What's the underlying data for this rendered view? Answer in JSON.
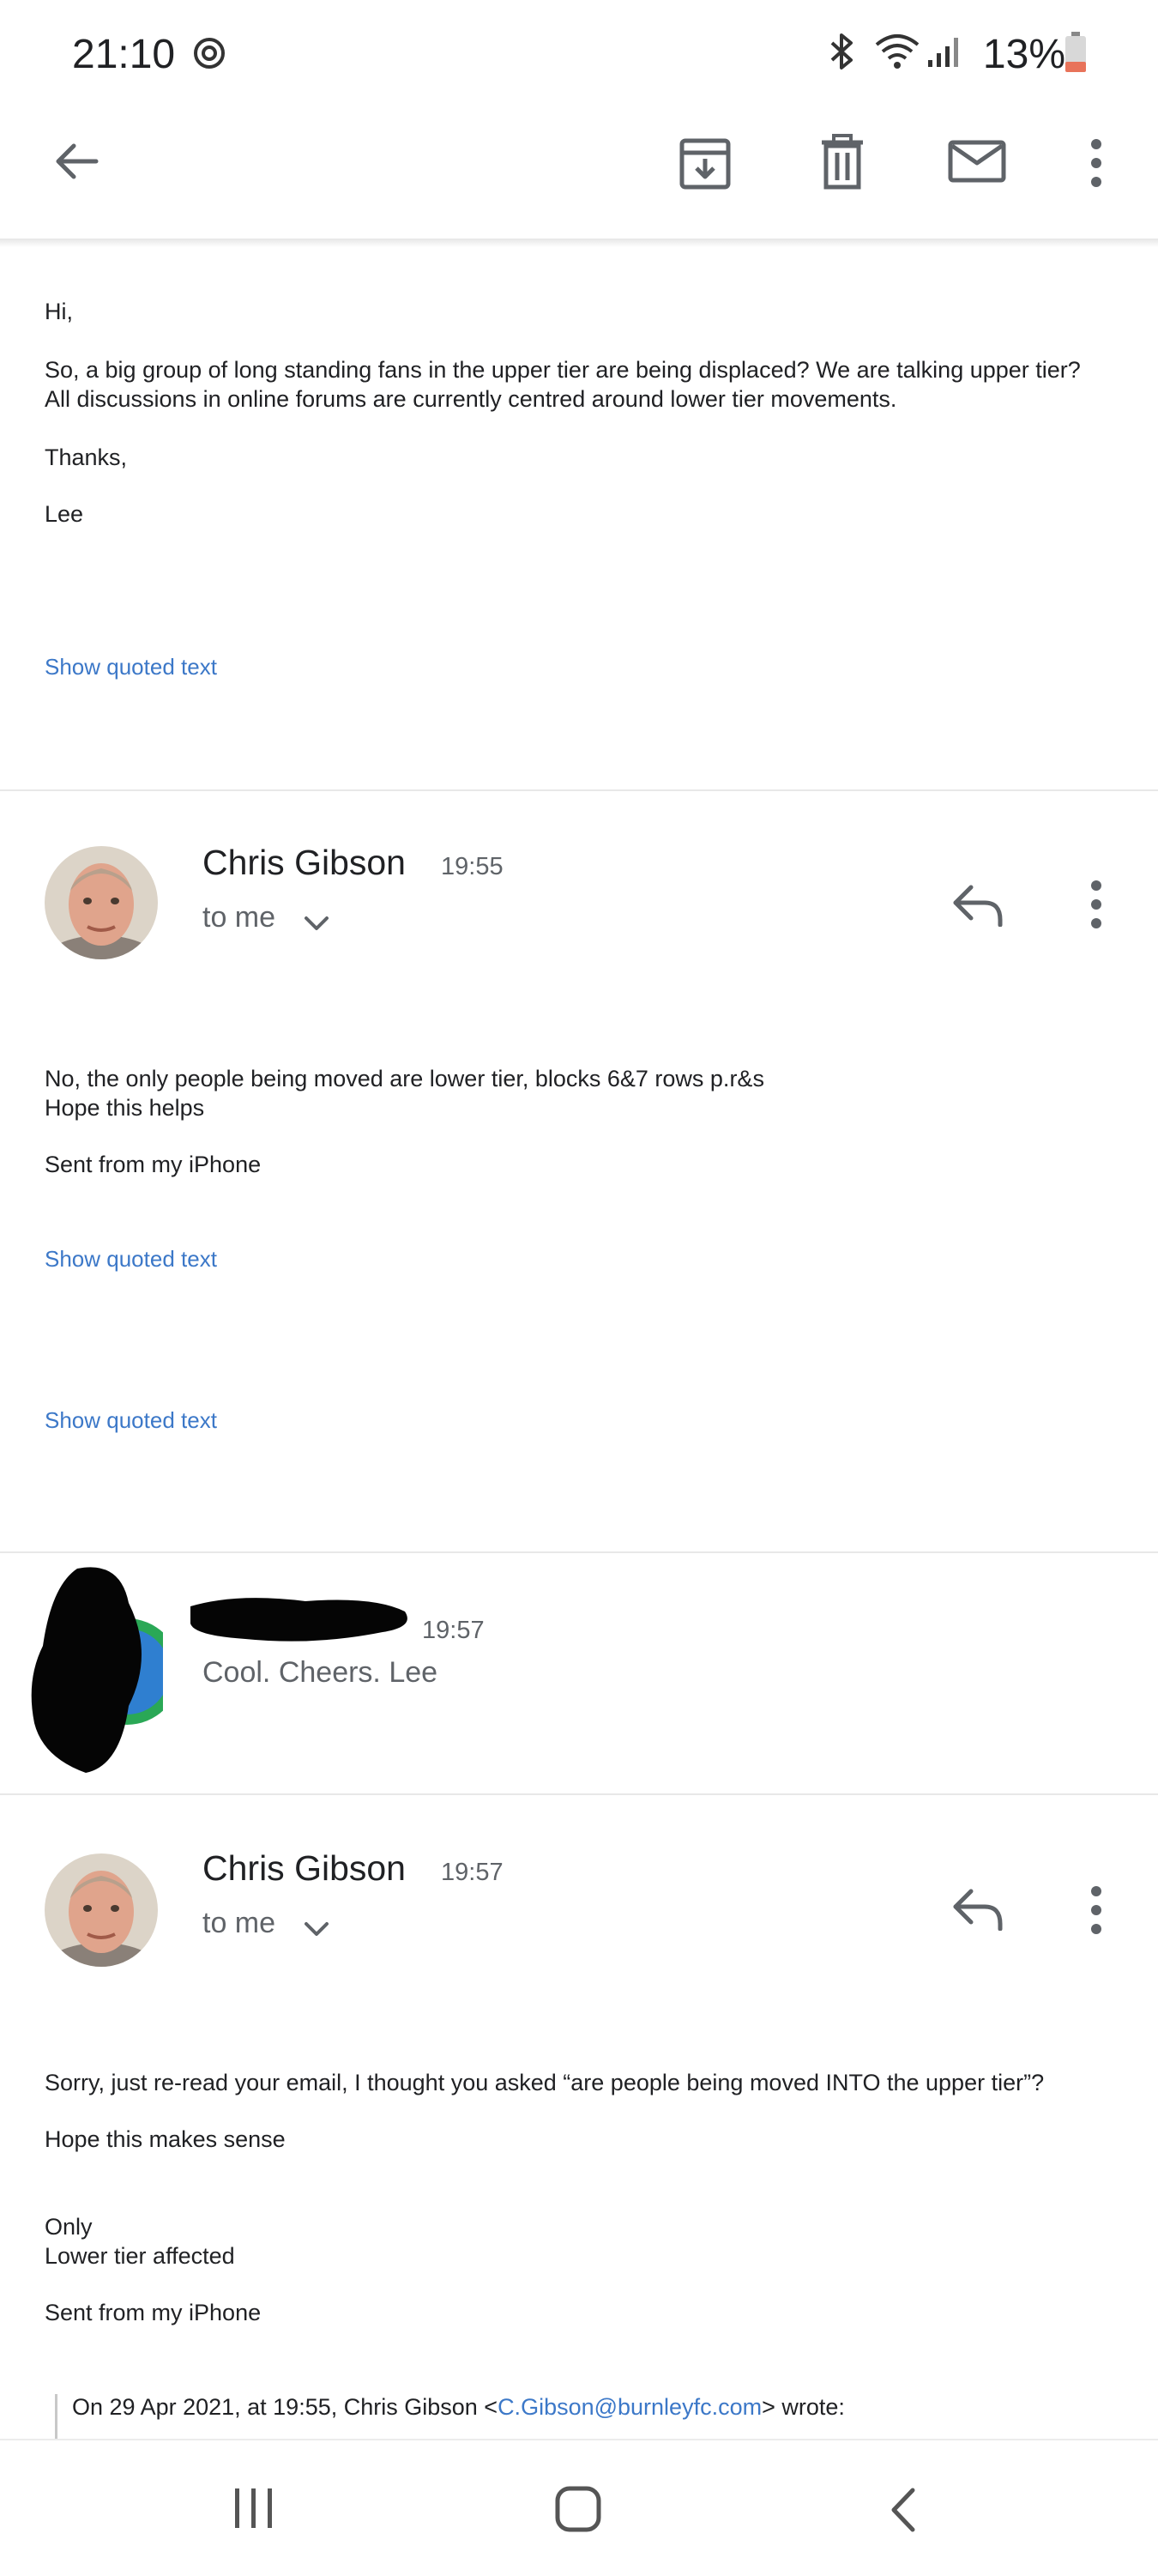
{
  "status_bar": {
    "time": "21:10",
    "battery": "13%",
    "icons": [
      "sync-icon",
      "bluetooth-icon",
      "wifi-icon",
      "signal-icon",
      "battery-icon"
    ]
  },
  "toolbar": {
    "back": "back-arrow-icon",
    "archive": "archive-icon",
    "delete": "trash-icon",
    "unread": "mail-icon",
    "more": "more-vert-icon"
  },
  "messages": [
    {
      "body": [
        "Hi,",
        "So, a big group of long standing fans in the upper tier are being displaced? We are talking upper tier? All discussions in online forums are currently centred around lower tier movements.",
        "Thanks,",
        "Lee"
      ],
      "show_quoted": "Show quoted text"
    },
    {
      "sender": "Chris Gibson",
      "time": "19:55",
      "to": "to me",
      "body": [
        "No, the only people being moved are lower tier, blocks 6&7 rows p.r&s",
        "Hope this helps",
        "Sent from my iPhone"
      ],
      "show_quoted": [
        "Show quoted text",
        "Show quoted text"
      ]
    },
    {
      "time": "19:57",
      "snippet": "Cool. Cheers. Lee"
    },
    {
      "sender": "Chris Gibson",
      "time": "19:57",
      "to": "to me",
      "body": [
        "Sorry, just re-read your email, I thought you asked “are people being moved INTO the upper tier”?",
        "Hope this makes sense",
        "Only",
        "Lower tier affected",
        "Sent from my iPhone"
      ],
      "quote_prefix": "On 29 Apr 2021, at 19:55, Chris Gibson <",
      "quote_email": "C.Gibson@burnleyfc.com",
      "quote_suffix": "> wrote:"
    }
  ],
  "colors": {
    "link": "#3c78c8",
    "text": "#202124",
    "secondary": "#5f6368",
    "battery_low": "#e8735a"
  },
  "nav_bar": [
    "recent-apps-icon",
    "home-icon",
    "back-icon"
  ]
}
